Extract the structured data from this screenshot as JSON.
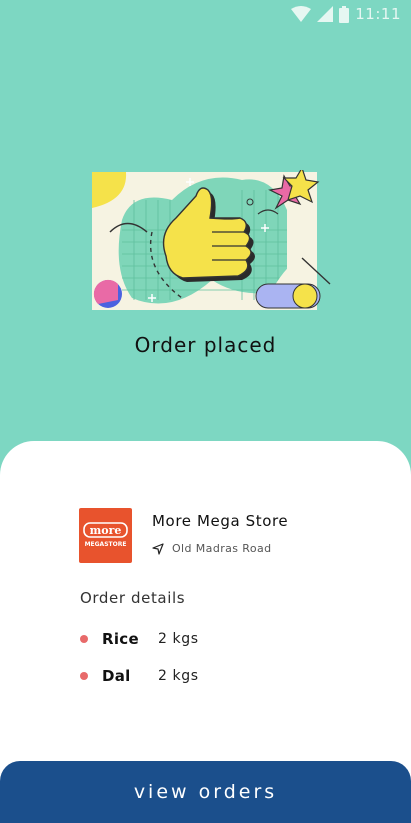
{
  "status_bar": {
    "time": "11:11",
    "icons": [
      "wifi-icon",
      "cell-signal-icon",
      "battery-icon"
    ]
  },
  "confirmation": {
    "title": "Order placed",
    "illustration": "thumbs-up-illustration"
  },
  "store": {
    "logo_top": "more",
    "logo_bottom": "MEGASTORE",
    "name": "More Mega Store",
    "location": "Old Madras Road",
    "location_icon": "navigation-arrow-icon"
  },
  "order_details": {
    "title": "Order details",
    "items": [
      {
        "name": "Rice",
        "qty": "2 kgs"
      },
      {
        "name": "Dal",
        "qty": "2 kgs"
      }
    ]
  },
  "actions": {
    "view_orders_label": "view orders"
  },
  "colors": {
    "background": "#7dd7c2",
    "primary": "#1b4f8c",
    "bullet": "#e86a6a",
    "logo": "#e8532d"
  }
}
